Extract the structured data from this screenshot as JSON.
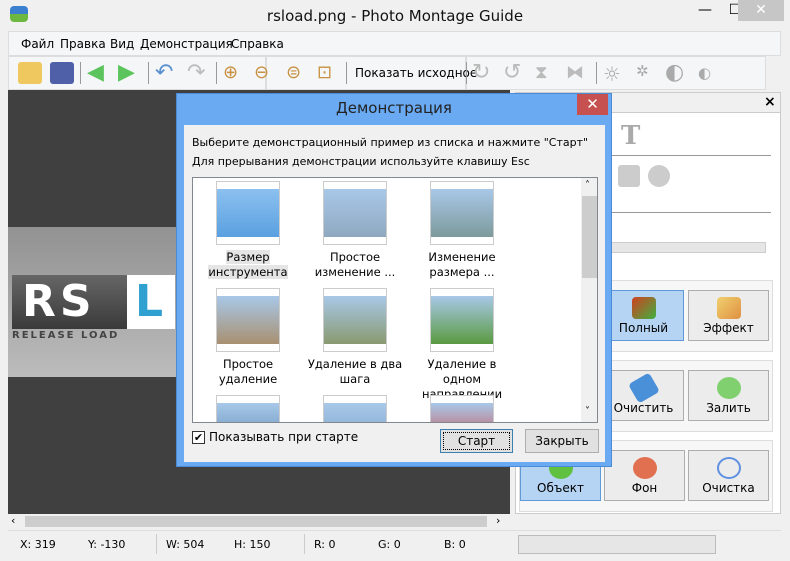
{
  "window": {
    "title": "rsload.png - Photo Montage Guide",
    "minimize": "—",
    "maximize": "☐",
    "close": "✕"
  },
  "menu": [
    "Файл",
    "Правка",
    "Вид",
    "Демонстрация",
    "Справка"
  ],
  "toolbar": {
    "show_original": "Показать исходное",
    "icons": [
      "open-icon",
      "save-icon",
      "back-icon",
      "forward-icon",
      "undo-icon",
      "redo-icon",
      "zoom-in-icon",
      "zoom-out-icon",
      "zoom-fit-icon",
      "zoom-actual-icon",
      "rotate-cw-icon",
      "rotate-ccw-icon",
      "flip-vertical-icon",
      "flip-horizontal-icon",
      "brightness-up-icon",
      "brightness-down-icon",
      "contrast-up-icon",
      "contrast-down-icon"
    ]
  },
  "canvas": {
    "logo_main": "RSL",
    "logo_sub": "RELEASE LOAD"
  },
  "panel": {
    "close": "×",
    "text_icon": "T",
    "buttons": {
      "full": "Полный",
      "effect": "Эффект",
      "clear": "Очистить",
      "fill": "Залить",
      "object": "Объект",
      "background": "Фон",
      "erase": "Очистка"
    }
  },
  "status": {
    "x": "X: 319",
    "y": "Y: -130",
    "w": "W: 504",
    "h": "H: 150",
    "r": "R: 0",
    "g": "G: 0",
    "b": "B: 0"
  },
  "dialog": {
    "title": "Демонстрация",
    "close": "✕",
    "line1": "Выберите демонстрационный пример из списка и нажмите \"Старт\"",
    "line2": "Для прерывания демонстрации используйте клавишу Esc",
    "items": [
      {
        "label": "Размер инструмента",
        "color": "#5aa0e0"
      },
      {
        "label": "Простое изменение ...",
        "color": "#8fa8c0"
      },
      {
        "label": "Изменение размера ...",
        "color": "#7d9a9c"
      },
      {
        "label": "Простое удаление",
        "color": "#a89070"
      },
      {
        "label": "Удаление в два шага",
        "color": "#8a9a70"
      },
      {
        "label": "Удаление в одном направлении",
        "color": "#5a9a40"
      },
      {
        "label": "",
        "color": "#5a8ab8"
      },
      {
        "label": "",
        "color": "#7aa0c8"
      },
      {
        "label": "",
        "color": "#d04040"
      }
    ],
    "show_on_start": "Показывать при старте",
    "start": "Старт",
    "close_button": "Закрыть"
  }
}
